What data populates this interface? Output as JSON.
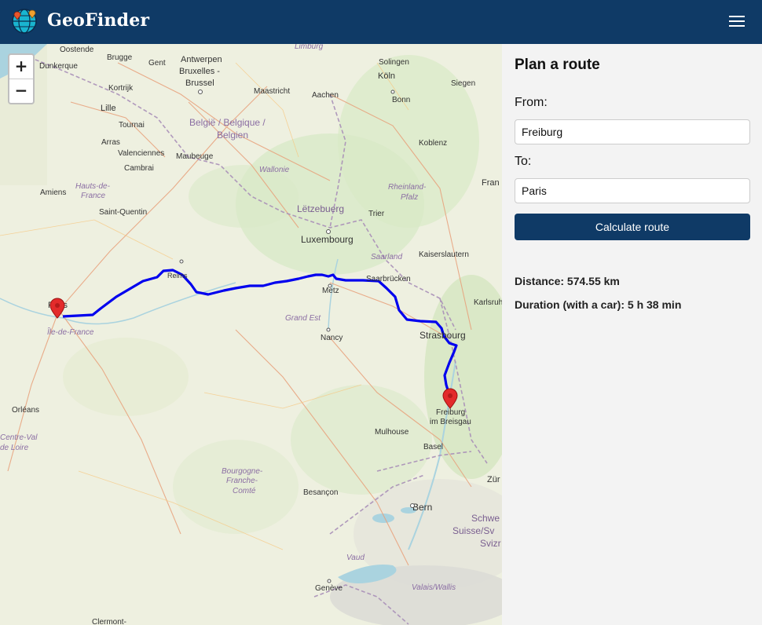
{
  "header": {
    "brand": "GeoFinder",
    "logo_icon": "globe-pin-icon",
    "menu_icon": "hamburger-menu-icon",
    "color": "#0f3a66"
  },
  "map": {
    "zoom_in": "+",
    "zoom_out": "−",
    "route_color": "#0000ee",
    "marker_color": "#e32b2b",
    "city_labels": [
      "Oostende",
      "Brugge",
      "Gent",
      "Antwerpen",
      "Bruxelles -",
      "Brussel",
      "Maastricht",
      "Aachen",
      "Köln",
      "Solingen",
      "Siegen",
      "Dunkerque",
      "Kortrijk",
      "Lille",
      "Tournai",
      "Arras",
      "Valenciennes",
      "Cambrai",
      "Maubeuge",
      "Amiens",
      "Saint-Quentin",
      "Reims",
      "Paris",
      "Orléans",
      "Metz",
      "Nancy",
      "Trier",
      "Luxembourg",
      "Saarbrücken",
      "Kaiserslautern",
      "Koblenz",
      "Karlsruhe",
      "Strasbourg",
      "Freiburg",
      "im Breisgau",
      "Mulhouse",
      "Basel",
      "Bern",
      "Besançon",
      "Genève",
      "Clermont-",
      "Bonn",
      "Limburg",
      "Fran"
    ],
    "region_labels": [
      "België / Belgique /",
      "Belgien",
      "Wallonie",
      "Hauts-de-",
      "France",
      "Île-de-France",
      "Grand Est",
      "Rheinland-",
      "Pfalz",
      "Saarland",
      "Bourgogne-",
      "Franche-",
      "Comté",
      "Centre-Val",
      "de Loire",
      "Vaud",
      "Valais/Wallis",
      "Schwe",
      "Suisse/Sv",
      "Svizr",
      "Lëtzebuerg",
      "Zür"
    ]
  },
  "panel": {
    "title": "Plan a route",
    "from_label": "From:",
    "from_value": "Freiburg",
    "to_label": "To:",
    "to_value": "Paris",
    "button": "Calculate route",
    "distance": "Distance: 574.55 km",
    "duration": "Duration (with a car): 5 h 38 min"
  }
}
